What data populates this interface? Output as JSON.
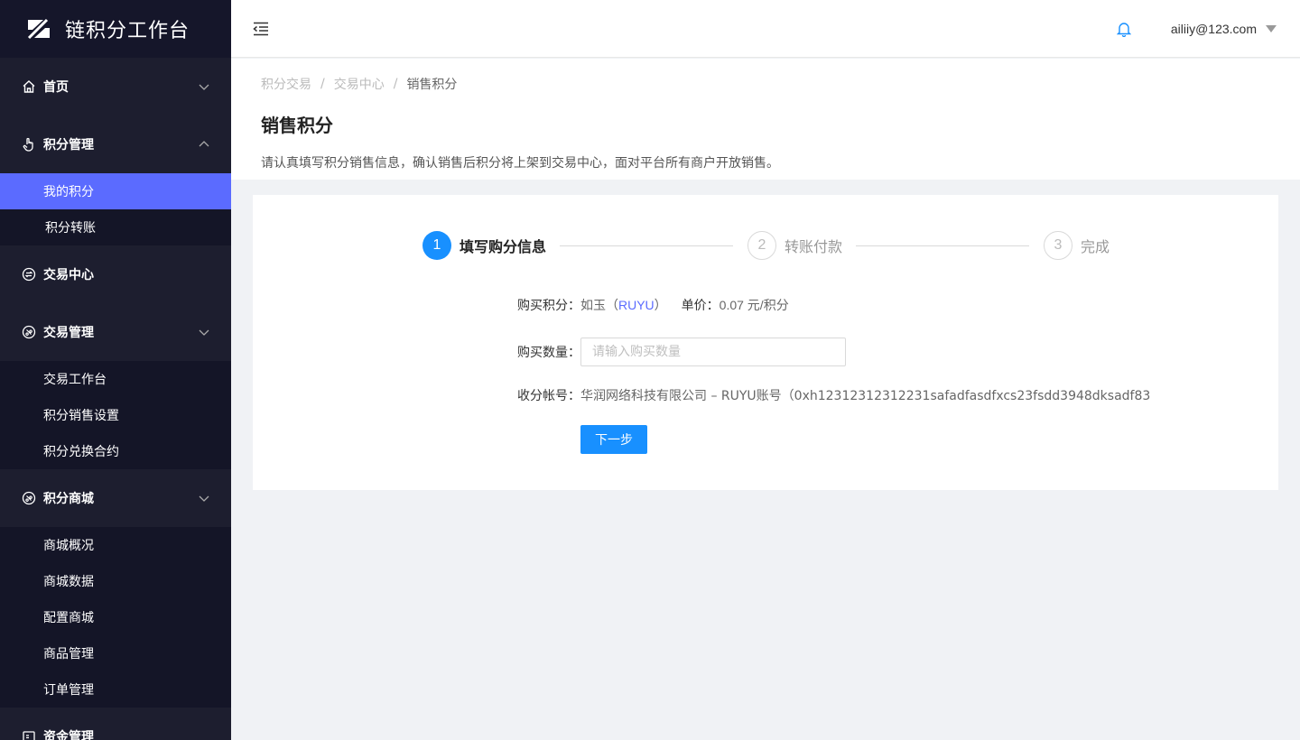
{
  "app": {
    "title": "链积分工作台"
  },
  "sidebar": {
    "groups": [
      {
        "label": "首页",
        "icon": "home-icon",
        "expanded": false,
        "items": []
      },
      {
        "label": "积分管理",
        "icon": "hand-pointer-icon",
        "expanded": true,
        "items": [
          "我的积分",
          "积分转账"
        ]
      },
      {
        "label": "交易中心",
        "icon": "exchange-icon",
        "expanded": false,
        "items": []
      },
      {
        "label": "交易管理",
        "icon": "trade-icon",
        "expanded": true,
        "items": [
          "交易工作台",
          "积分销售设置",
          "积分兑换合约"
        ]
      },
      {
        "label": "积分商城",
        "icon": "mall-icon",
        "expanded": true,
        "items": [
          "商城概况",
          "商城数据",
          "配置商城",
          "商品管理",
          "订单管理"
        ]
      },
      {
        "label": "资金管理",
        "icon": "wallet-icon",
        "expanded": false,
        "items": []
      }
    ],
    "active_item": "我的积分"
  },
  "header": {
    "user_email": "ailiiy@123.com"
  },
  "breadcrumb": [
    "积分交易",
    "交易中心",
    "销售积分"
  ],
  "page": {
    "title": "销售积分",
    "description": "请认真填写积分销售信息，确认销售后积分将上架到交易中心，面对平台所有商户开放销售。"
  },
  "steps": [
    {
      "num": "1",
      "label": "填写购分信息",
      "state": "active"
    },
    {
      "num": "2",
      "label": "转账付款",
      "state": "todo"
    },
    {
      "num": "3",
      "label": "完成",
      "state": "todo"
    }
  ],
  "form": {
    "buy_points_label": "购买积分：",
    "buy_points_name": "如玉（",
    "buy_points_code": "RUYU",
    "buy_points_close": "）",
    "unit_price_label": "单价：",
    "unit_price_value": "0.07 元/积分",
    "quantity_label": "购买数量：",
    "quantity_placeholder": "请输入购买数量",
    "account_label": "收分帐号：",
    "account_value": "华润网络科技有限公司 – RUYU账号（0xh12312312312231safadfasdfxcs23fsdd3948dksadf83",
    "next_button": "下一步"
  },
  "colors": {
    "primary": "#1890ff",
    "active_menu": "#5b6bff",
    "sidebar_bg": "#1d1e2f"
  }
}
